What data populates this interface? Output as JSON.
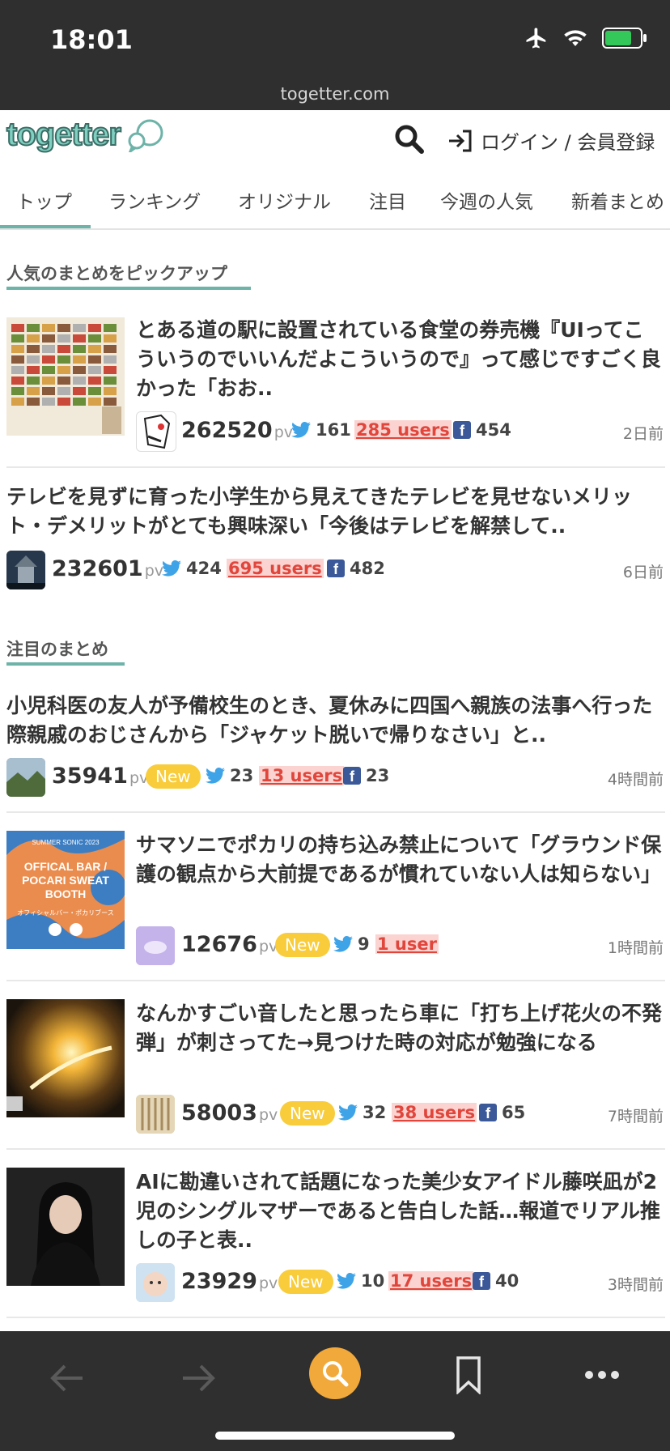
{
  "status": {
    "time": "18:01",
    "battery_level": 0.8
  },
  "browser": {
    "url": "togetter.com"
  },
  "header": {
    "logo_text": "togetter",
    "login_text": "ログイン / 会員登録"
  },
  "tabs": [
    {
      "label": "トップ"
    },
    {
      "label": "ランキング"
    },
    {
      "label": "オリジナル"
    },
    {
      "label": "注目"
    },
    {
      "label": "今週の人気"
    },
    {
      "label": "新着まとめ"
    }
  ],
  "sections": {
    "pickup": {
      "title": "人気のまとめをピックアップ"
    },
    "featured": {
      "title": "注目のまとめ"
    }
  },
  "pv_unit": "pv",
  "new_label": "New",
  "articles": [
    {
      "title": "とある道の駅に設置されている食堂の券売機『UIってこういうのでいいんだよこういうので』って感じですごく良かった「おお..",
      "pv": "262520",
      "tweets": "161",
      "users": "285 users",
      "fb": "454",
      "age": "2日前",
      "is_new": false
    },
    {
      "title": "テレビを見ずに育った小学生から見えてきたテレビを見せないメリット・デメリットがとても興味深い「今後はテレビを解禁して..",
      "pv": "232601",
      "tweets": "424",
      "users": "695 users",
      "fb": "482",
      "age": "6日前",
      "is_new": false
    },
    {
      "title": "小児科医の友人が予備校生のとき、夏休みに四国へ親族の法事へ行った際親戚のおじさんから「ジャケット脱いで帰りなさい」と..",
      "pv": "35941",
      "tweets": "23",
      "users": "13 users",
      "fb": "23",
      "age": "4時間前",
      "is_new": true
    },
    {
      "title": "サマソニでポカリの持ち込み禁止について「グラウンド保護の観点から大前提であるが慣れていない人は知らない」",
      "pv": "12676",
      "tweets": "9",
      "users": "1 user",
      "fb": "",
      "age": "1時間前",
      "is_new": true
    },
    {
      "title": "なんかすごい音したと思ったら車に「打ち上げ花火の不発弾」が刺さってた→見つけた時の対応が勉強になる",
      "pv": "58003",
      "tweets": "32",
      "users": "38 users",
      "fb": "65",
      "age": "7時間前",
      "is_new": true
    },
    {
      "title": "AIに勘違いされて話題になった美少女アイドル藤咲凪が2児のシングルマザーであると告白した話…報道でリアル推しの子と表..",
      "pv": "23929",
      "tweets": "10",
      "users": "17 users",
      "fb": "40",
      "age": "3時間前",
      "is_new": true
    }
  ],
  "thumb_texts": {
    "sonic_top": "SUMMER SONIC 2023",
    "sonic_main": "OFFICAL BAR / POCARI SWEAT BOOTH",
    "sonic_sub": "オフィシャルバー・ポカリブース"
  },
  "colors": {
    "accent": "#6db3a8",
    "users_red": "#e0463c",
    "new_yellow": "#f8cc3b",
    "search_orange": "#f2a93b"
  }
}
